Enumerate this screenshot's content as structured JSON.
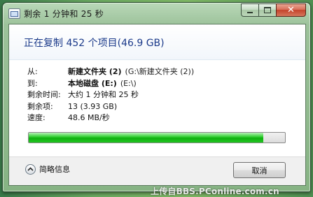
{
  "window": {
    "title": "剩余 1 分钟和 25 秒",
    "buttons": {
      "minimize": "minimize",
      "maximize": "maximize",
      "close": "close"
    }
  },
  "heading": "正在复制 452 个项目(46.9 GB)",
  "details": {
    "from_label": "从:",
    "from_name": "新建文件夹 (2)",
    "from_path": "(G:\\新建文件夹 (2))",
    "to_label": "到:",
    "to_name": "本地磁盘 (E:)",
    "to_path": "(E:\\)",
    "time_label": "剩余时间:",
    "time_value": "大约 1 分钟和 25 秒",
    "items_label": "剩余项:",
    "items_value": "13 (3.93 GB)",
    "speed_label": "速度:",
    "speed_value": "48.6 MB/秒"
  },
  "progress": {
    "percent": 91.6,
    "color": "#19b819"
  },
  "footer": {
    "details_toggle": "简略信息",
    "cancel": "取消"
  },
  "watermark": "上传自BBS.PConline.com.cn"
}
